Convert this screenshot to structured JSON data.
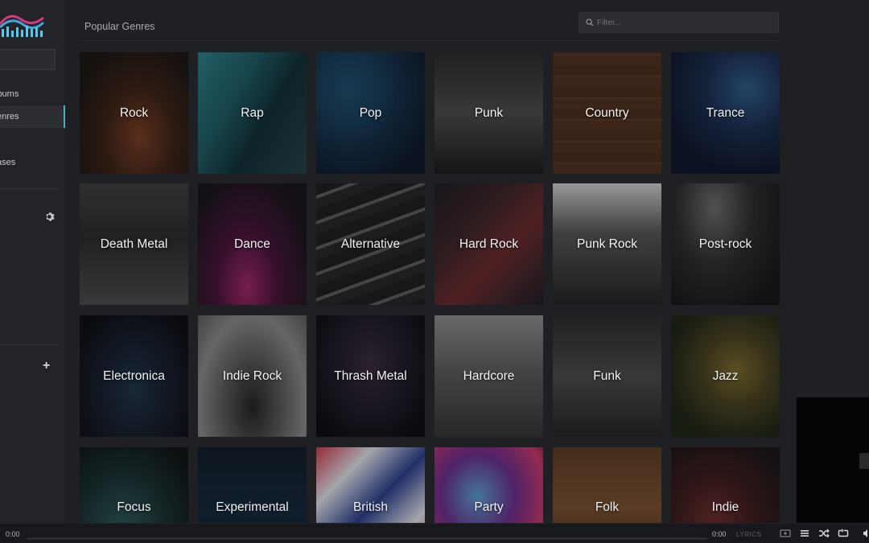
{
  "sidebar": {
    "items": [
      {
        "label": "lbums"
      },
      {
        "label": "enres"
      },
      {
        "label": "ases"
      }
    ]
  },
  "main": {
    "title": "Popular Genres",
    "filter_placeholder": "Filter..."
  },
  "genres": [
    {
      "label": "Rock"
    },
    {
      "label": "Rap"
    },
    {
      "label": "Pop"
    },
    {
      "label": "Punk"
    },
    {
      "label": "Country"
    },
    {
      "label": "Trance"
    },
    {
      "label": "Death Metal"
    },
    {
      "label": "Dance"
    },
    {
      "label": "Alternative"
    },
    {
      "label": "Hard Rock"
    },
    {
      "label": "Punk Rock"
    },
    {
      "label": "Post-rock"
    },
    {
      "label": "Electronica"
    },
    {
      "label": "Indie Rock"
    },
    {
      "label": "Thrash Metal"
    },
    {
      "label": "Hardcore"
    },
    {
      "label": "Funk"
    },
    {
      "label": "Jazz"
    },
    {
      "label": "Focus"
    },
    {
      "label": "Experimental"
    },
    {
      "label": "British"
    },
    {
      "label": "Party"
    },
    {
      "label": "Folk"
    },
    {
      "label": "Indie"
    }
  ],
  "player": {
    "elapsed": "0:00",
    "duration": "0:00",
    "lyrics_label": "LYRICS",
    "progress_fraction": 0
  },
  "icons": {
    "settings": "gear-icon",
    "add": "plus-icon",
    "search": "search-icon",
    "video": "video-icon",
    "queue": "queue-icon",
    "shuffle": "shuffle-icon",
    "repeat": "repeat-icon"
  },
  "colors": {
    "accent": "#3fb9c6",
    "background": "#1f2024",
    "sidebar": "#232429"
  }
}
